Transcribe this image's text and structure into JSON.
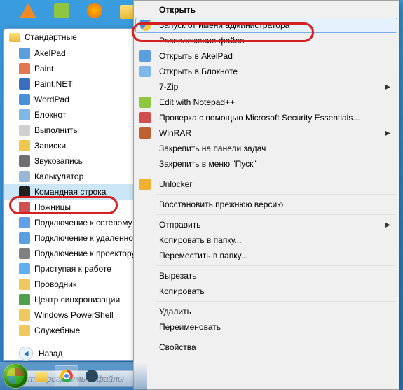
{
  "startMenu": {
    "folderLabel": "Стандартные",
    "items": [
      {
        "label": "AkelPad",
        "icon": "#5a9edc"
      },
      {
        "label": "Paint",
        "icon": "#e27750"
      },
      {
        "label": "Paint.NET",
        "icon": "#3a6fc0"
      },
      {
        "label": "WordPad",
        "icon": "#4a90d9"
      },
      {
        "label": "Блокнот",
        "icon": "#7fb8e8"
      },
      {
        "label": "Выполнить",
        "icon": "#d0d0d0"
      },
      {
        "label": "Записки",
        "icon": "#f0c850"
      },
      {
        "label": "Звукозапись",
        "icon": "#707070"
      },
      {
        "label": "Калькулятор",
        "icon": "#9ab8d8"
      },
      {
        "label": "Командная строка",
        "icon": "#202020",
        "sel": true,
        "highlighted": true
      },
      {
        "label": "Ножницы",
        "icon": "#d05050"
      },
      {
        "label": "Подключение к сетевому",
        "icon": "#60a0e8"
      },
      {
        "label": "Подключение к удаленно",
        "icon": "#5aa0e0"
      },
      {
        "label": "Подключение к проектору",
        "icon": "#808080"
      },
      {
        "label": "Приступая к работе",
        "icon": "#60b0f0"
      },
      {
        "label": "Проводник",
        "icon": "#f0c860"
      },
      {
        "label": "Центр синхронизации",
        "icon": "#50a050"
      },
      {
        "label": "Windows PowerShell",
        "icon": "#f0c860",
        "folder": true
      },
      {
        "label": "Служебные",
        "icon": "#f0c860",
        "folder": true
      }
    ],
    "backLabel": "Назад",
    "searchPlaceholder": "Найти программы и файлы"
  },
  "contextMenu": {
    "groups": [
      [
        {
          "label": "Открыть",
          "bold": true
        },
        {
          "label": "Запуск от имени администратора",
          "icon": "shield",
          "hov": true,
          "highlighted": true
        },
        {
          "label": "Расположение файла"
        },
        {
          "label": "Открыть в AkelPad",
          "icon": "#5a9edc"
        },
        {
          "label": "Открыть в Блокноте",
          "icon": "#7fb8e8"
        },
        {
          "label": "7-Zip",
          "sub": true
        },
        {
          "label": "Edit with Notepad++",
          "icon": "#8fc63f"
        },
        {
          "label": "Проверка с помощью Microsoft Security Essentials...",
          "icon": "#d05050"
        },
        {
          "label": "WinRAR",
          "icon": "#c06030",
          "sub": true
        },
        {
          "label": "Закрепить на панели задач"
        },
        {
          "label": "Закрепить в меню \"Пуск\""
        }
      ],
      [
        {
          "label": "Unlocker",
          "icon": "#f0b030"
        }
      ],
      [
        {
          "label": "Восстановить прежнюю версию"
        }
      ],
      [
        {
          "label": "Отправить",
          "sub": true
        },
        {
          "label": "Копировать в папку..."
        },
        {
          "label": "Переместить в папку..."
        }
      ],
      [
        {
          "label": "Вырезать"
        },
        {
          "label": "Копировать"
        }
      ],
      [
        {
          "label": "Удалить"
        },
        {
          "label": "Переименовать"
        }
      ],
      [
        {
          "label": "Свойства"
        }
      ]
    ]
  },
  "taskbar": {
    "buttons": [
      "explorer",
      "chrome",
      "steam"
    ]
  }
}
